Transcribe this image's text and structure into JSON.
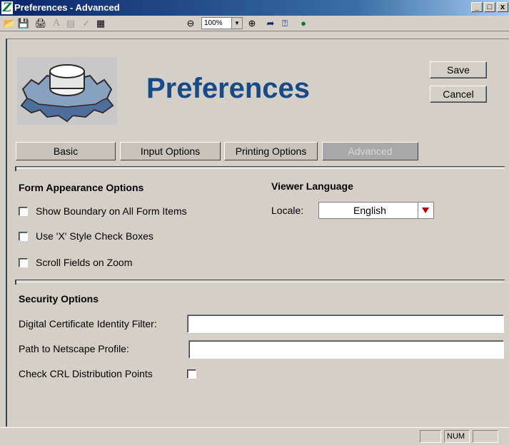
{
  "window": {
    "title": "Preferences - Advanced",
    "app_icon": "Z",
    "controls": [
      "_",
      "□",
      "x"
    ]
  },
  "toolbar": {
    "zoom_value": "100%"
  },
  "header": {
    "title": "Preferences",
    "save_label": "Save",
    "cancel_label": "Cancel"
  },
  "tabs": [
    {
      "label": "Basic",
      "active": false
    },
    {
      "label": "Input Options",
      "active": false
    },
    {
      "label": "Printing Options",
      "active": false
    },
    {
      "label": "Advanced",
      "active": true
    }
  ],
  "form_appearance": {
    "heading": "Form Appearance Options",
    "options": [
      {
        "label": "Show Boundary on All Form Items",
        "checked": false
      },
      {
        "label": "Use 'X' Style Check Boxes",
        "checked": false
      },
      {
        "label": "Scroll Fields on Zoom",
        "checked": false
      }
    ]
  },
  "viewer_language": {
    "heading": "Viewer Language",
    "locale_label": "Locale:",
    "locale_value": "English"
  },
  "security": {
    "heading": "Security Options",
    "identity_filter_label": "Digital Certificate Identity Filter:",
    "identity_filter_value": "",
    "netscape_profile_label": "Path to Netscape Profile:",
    "netscape_profile_value": "",
    "crl_label": "Check CRL Distribution Points",
    "crl_checked": false
  },
  "statusbar": {
    "num": "NUM"
  },
  "colors": {
    "title_color": "#174a87",
    "titlebar": "#0a246a",
    "dropdown_arrow": "#b00000"
  }
}
